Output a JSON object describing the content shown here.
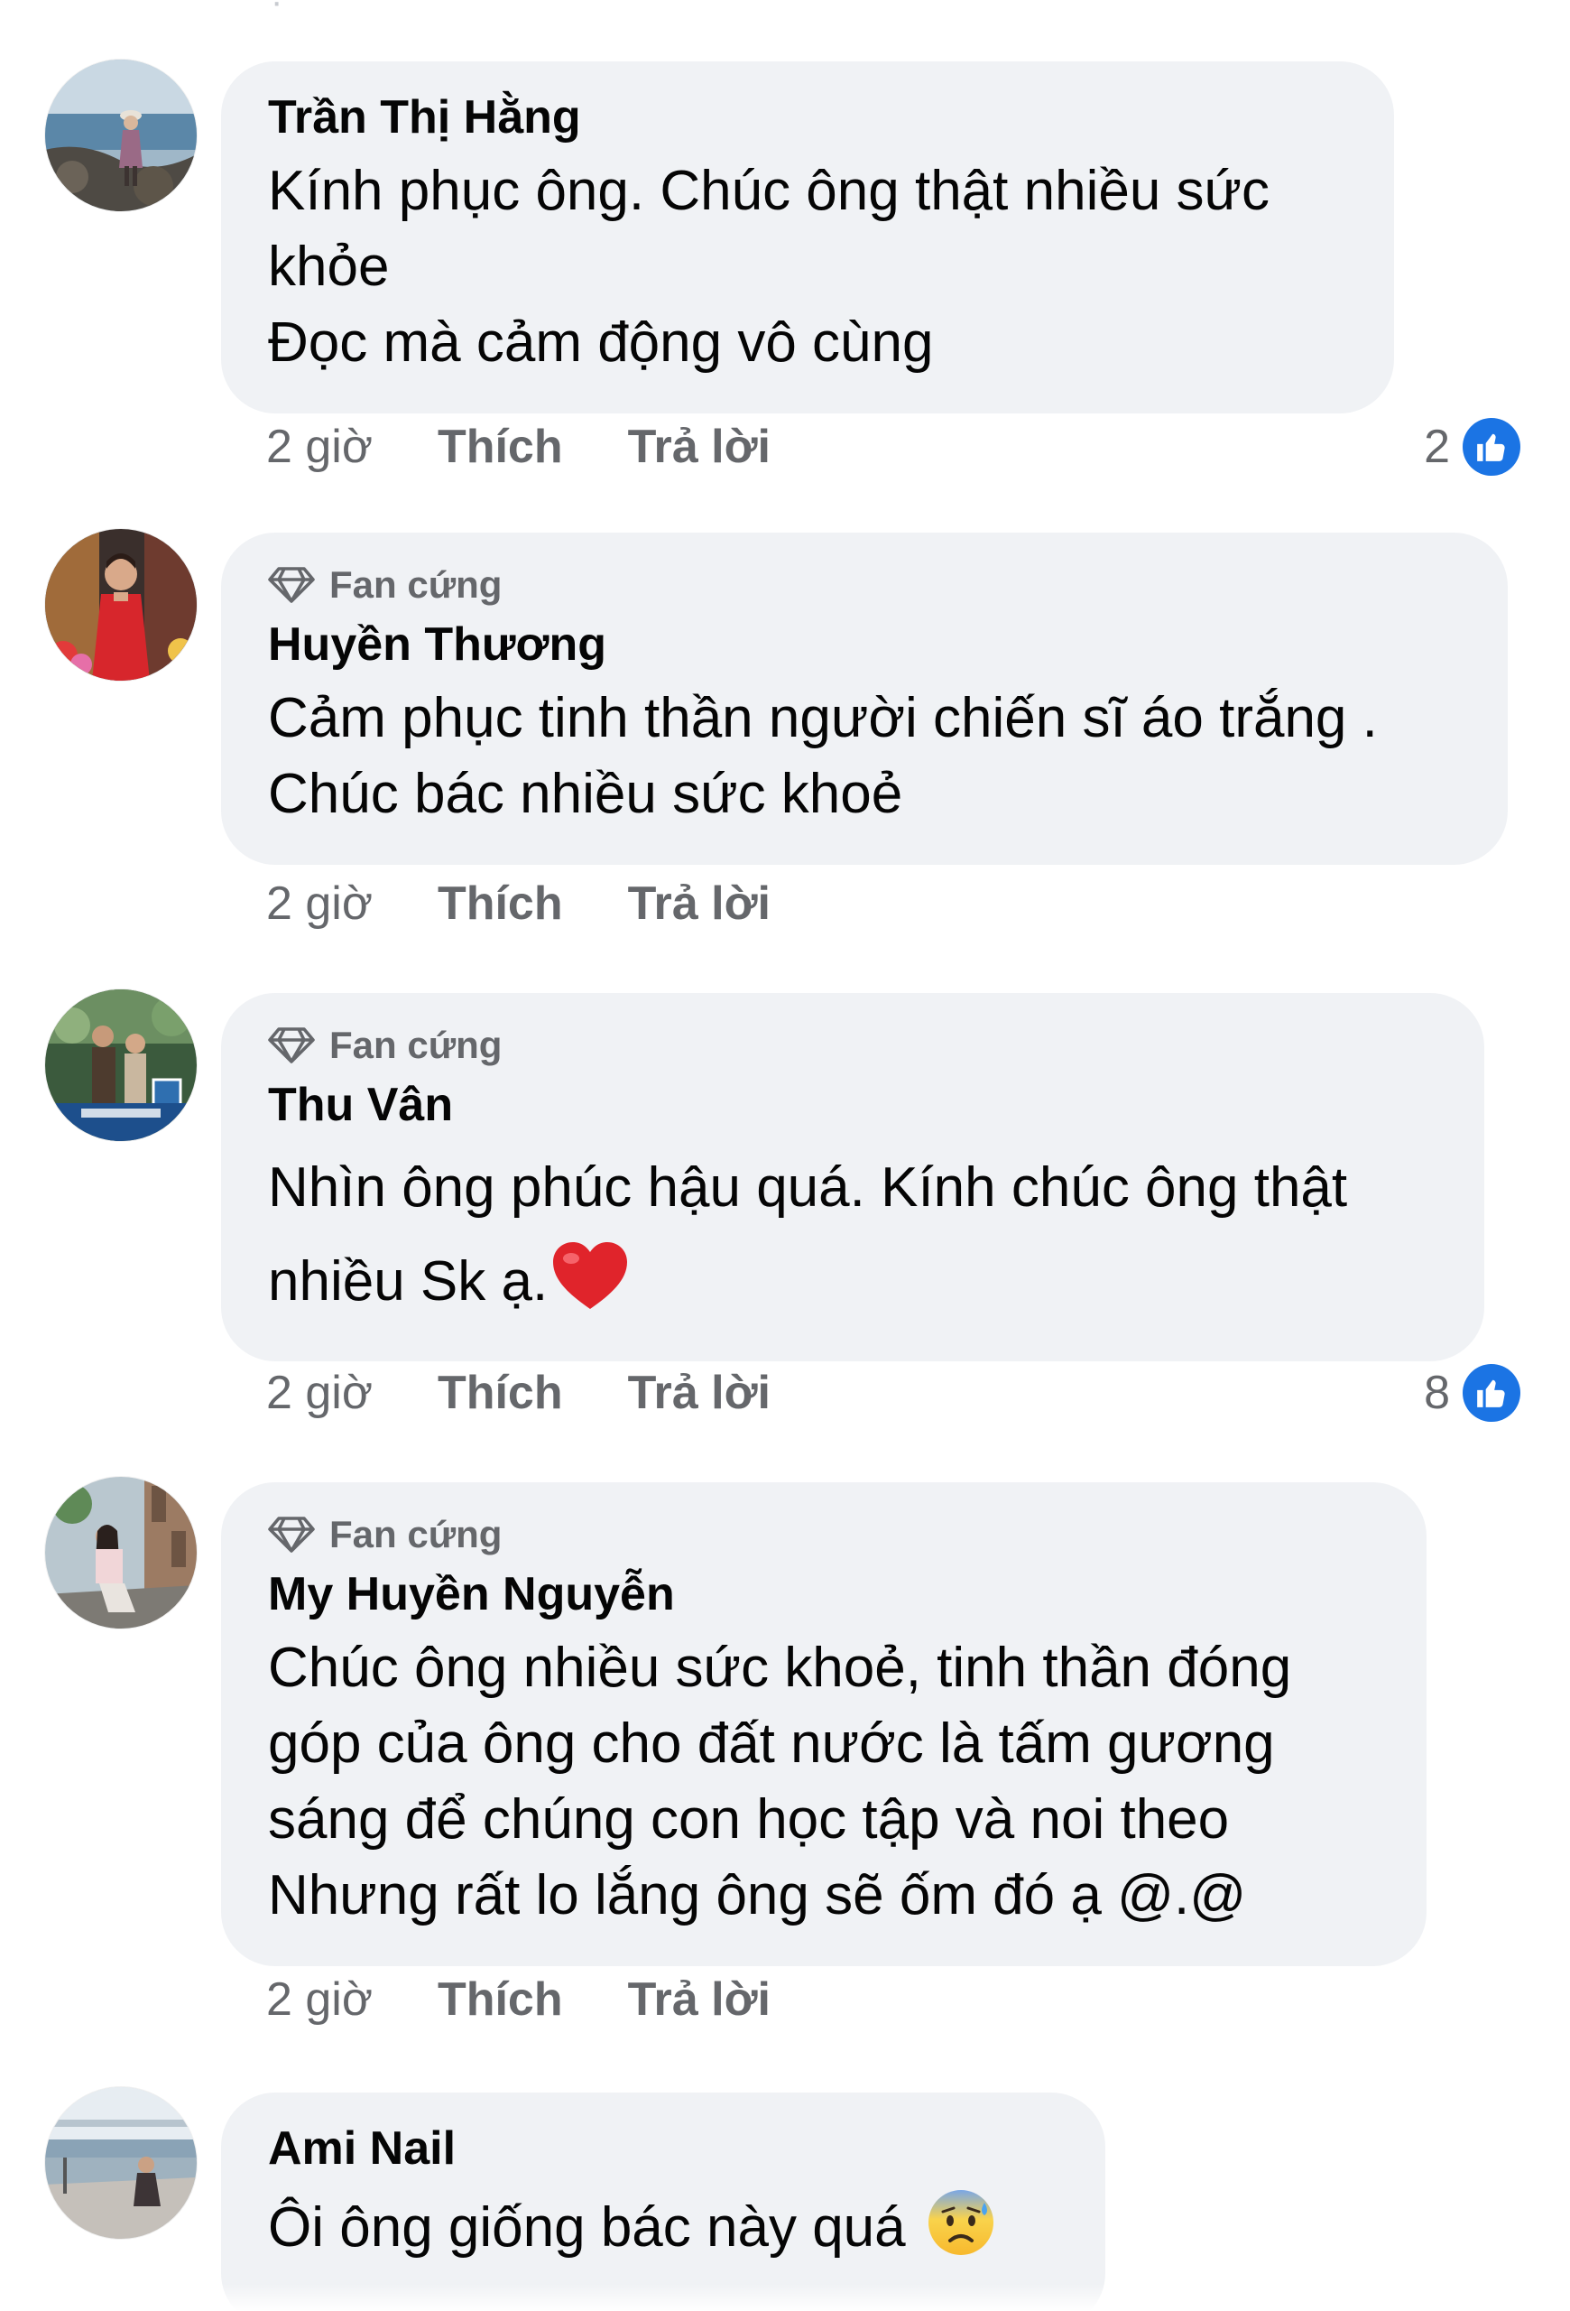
{
  "comments": [
    {
      "author": "Trần Thị Hằng",
      "badge": "",
      "lines": [
        "Kính phục ông. Chúc ông thật nhiều sức",
        "khỏe",
        "Đọc mà cảm động vô cùng"
      ],
      "time": "2 giờ",
      "like_label": "Thích",
      "reply_label": "Trả lời",
      "reactions": "2",
      "reaction_icon": "like-icon",
      "avatar_icon": "avatar-woman-seaside"
    },
    {
      "author": "Huyền Thương",
      "badge": "Fan cứng",
      "lines": [
        "Cảm phục tinh thần người chiến sĩ áo trắng .",
        "Chúc bác nhiều sức khoẻ"
      ],
      "time": "2 giờ",
      "like_label": "Thích",
      "reply_label": "Trả lời",
      "reactions": "",
      "avatar_icon": "avatar-woman-red-dress"
    },
    {
      "author": "Thu Vân",
      "badge": "Fan cứng",
      "lines": [
        "Nhìn ông phúc hậu quá. Kính chúc ông thật",
        "nhiều Sk ạ."
      ],
      "emoji": "red-heart-emoji",
      "time": "2 giờ",
      "like_label": "Thích",
      "reply_label": "Trả lời",
      "reactions": "8",
      "reaction_icon": "like-icon",
      "avatar_icon": "avatar-couple-frame"
    },
    {
      "author": "My Huyền Nguyễn",
      "badge": "Fan cứng",
      "lines": [
        "Chúc ông nhiều sức khoẻ, tinh thần đóng",
        "góp của ông cho đất nước là tấm gương",
        "sáng để chúng con học tập và noi theo",
        "Nhưng rất lo lắng ông sẽ ốm đó ạ @.@"
      ],
      "time": "2 giờ",
      "like_label": "Thích",
      "reply_label": "Trả lời",
      "reactions": "",
      "avatar_icon": "avatar-woman-street"
    },
    {
      "author": "Ami Nail",
      "badge": "",
      "lines": [
        "Ôi ông giống bác này quá"
      ],
      "emoji": "anxious-sweat-emoji",
      "avatar_icon": "avatar-woman-lakeside"
    }
  ],
  "colors": {
    "bubble": "#f0f2f5",
    "secondary_text": "#65676b",
    "like_blue": "#1b74e4",
    "heart_red": "#e0242b"
  },
  "icons": {
    "badge": "diamond-icon",
    "reaction": "thumbs-up-icon"
  }
}
